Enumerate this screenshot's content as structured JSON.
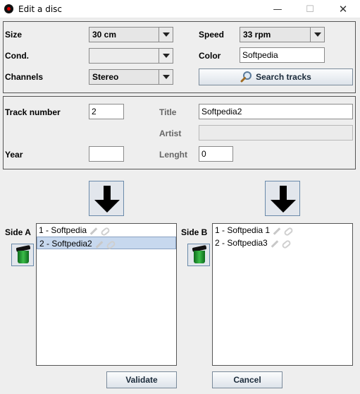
{
  "window": {
    "title": "Edit a disc",
    "minimize_glyph": "—",
    "maximize_glyph": "☐",
    "close_glyph": "✕"
  },
  "disc": {
    "size_label": "Size",
    "size_value": "30 cm",
    "speed_label": "Speed",
    "speed_value": "33 rpm",
    "cond_label": "Cond.",
    "cond_value": "",
    "color_label": "Color",
    "color_value": "Softpedia",
    "channels_label": "Channels",
    "channels_value": "Stereo",
    "search_button": "Search tracks"
  },
  "track": {
    "number_label": "Track number",
    "number_value": "2",
    "title_label": "Title",
    "title_value": "Softpedia2",
    "artist_label": "Artist",
    "artist_value": "",
    "year_label": "Year",
    "year_value": "",
    "length_label": "Lenght",
    "length_value": "0"
  },
  "side_a": {
    "label": "Side A",
    "items": [
      "1 - Softpedia",
      "2 - Softpedia2"
    ],
    "selected_index": 1
  },
  "side_b": {
    "label": "Side B",
    "items": [
      "1 - Softpedia 1",
      "2 - Softpedia3"
    ]
  },
  "buttons": {
    "validate": "Validate",
    "cancel": "Cancel"
  },
  "icons": {
    "window": "record-icon",
    "search": "magnifier-icon",
    "add": "arrow-down-icon",
    "delete": "trash-icon",
    "edit": "pencil-icon",
    "link": "link-icon"
  }
}
